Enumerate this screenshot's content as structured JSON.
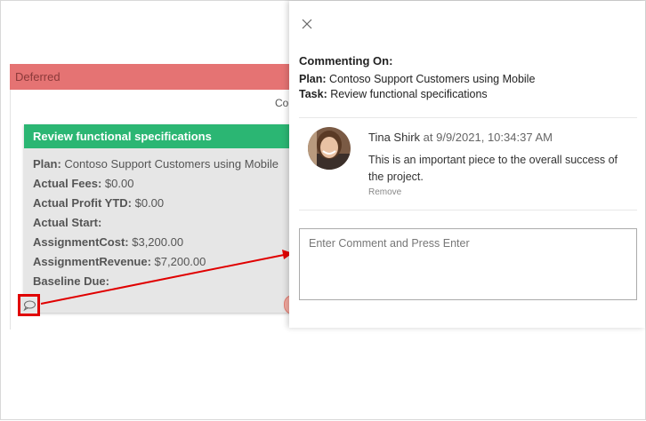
{
  "board": {
    "column_title": "Deferred",
    "column_partial_text": "Co",
    "card": {
      "title": "Review functional specifications",
      "rows": [
        {
          "label": "Plan:",
          "value": " Contoso Support Customers using Mobile"
        },
        {
          "label": "Actual Fees:",
          "value": " $0.00"
        },
        {
          "label": "Actual Profit YTD:",
          "value": " $0.00"
        },
        {
          "label": "Actual Start:",
          "value": ""
        },
        {
          "label": "AssignmentCost:",
          "value": " $3,200.00"
        },
        {
          "label": "AssignmentRevenue:",
          "value": " $7,200.00"
        },
        {
          "label": "Baseline Due:",
          "value": ""
        }
      ],
      "comment_icon": "speech-bubble-icon"
    }
  },
  "panel": {
    "close_icon": "close-icon",
    "commenting_on_label": "Commenting On:",
    "plan_label": "Plan:",
    "plan_value": " Contoso Support Customers using Mobile",
    "task_label": "Task:",
    "task_value": " Review functional specifications",
    "comment": {
      "author": "Tina Shirk",
      "date": " at 9/9/2021, 10:34:37 AM",
      "text": "This is an important piece to the overall success of the project.",
      "remove_label": "Remove"
    },
    "input_placeholder": "Enter Comment and Press Enter"
  },
  "colors": {
    "deferred": "#e57373",
    "card_header": "#2bb673",
    "highlight": "#e00000"
  }
}
